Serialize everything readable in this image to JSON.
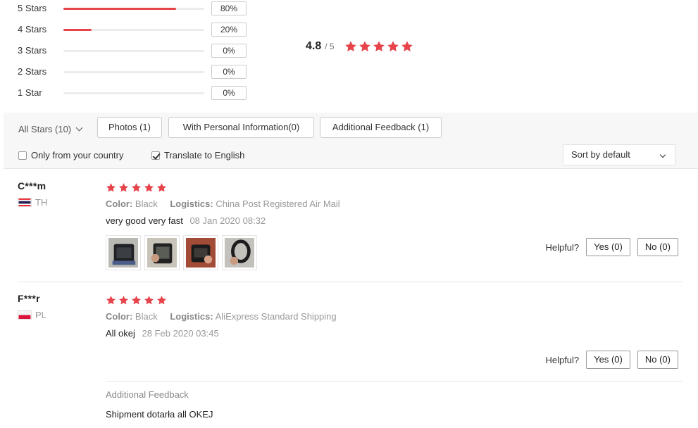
{
  "rating_breakdown": [
    {
      "label": "5 Stars",
      "percent_text": "80%",
      "fraction": 0.8
    },
    {
      "label": "4 Stars",
      "percent_text": "20%",
      "fraction": 0.2
    },
    {
      "label": "3 Stars",
      "percent_text": "0%",
      "fraction": 0.0
    },
    {
      "label": "2 Stars",
      "percent_text": "0%",
      "fraction": 0.0
    },
    {
      "label": "1 Star",
      "percent_text": "0%",
      "fraction": 0.0
    }
  ],
  "average": {
    "value": "4.8",
    "max": "/ 5",
    "stars": 5
  },
  "filters": {
    "all_stars": "All Stars (10)",
    "photos": "Photos (1)",
    "personal_info": "With Personal Information(0)",
    "additional_feedback": "Additional Feedback (1)",
    "only_country": "Only from your country",
    "only_country_checked": false,
    "translate": "Translate to English",
    "translate_checked": true,
    "sort": "Sort by default"
  },
  "colors": {
    "accent": "#e6434b",
    "star": "#e6434b"
  },
  "reviews": [
    {
      "name": "C***m",
      "country": "TH",
      "flag_icon": "thailand-flag-icon",
      "stars": 5,
      "color_label": "Color:",
      "color_value": "Black",
      "logistics_label": "Logistics:",
      "logistics_value": "China Post Registered Air Mail",
      "text": "very good very fast",
      "date": "08 Jan 2020 08:32",
      "helpful_label": "Helpful?",
      "yes": "Yes (0)",
      "no": "No (0)"
    },
    {
      "name": "F***r",
      "country": "PL",
      "flag_icon": "poland-flag-icon",
      "stars": 5,
      "color_label": "Color:",
      "color_value": "Black",
      "logistics_label": "Logistics:",
      "logistics_value": "AliExpress Standard Shipping",
      "text": "All okej",
      "date": "28 Feb 2020 03:45",
      "helpful_label": "Helpful?",
      "yes": "Yes (0)",
      "no": "No (0)",
      "additional_feedback_title": "Additional Feedback",
      "additional_feedback_text": "Shipment dotarła all OKEJ"
    }
  ]
}
